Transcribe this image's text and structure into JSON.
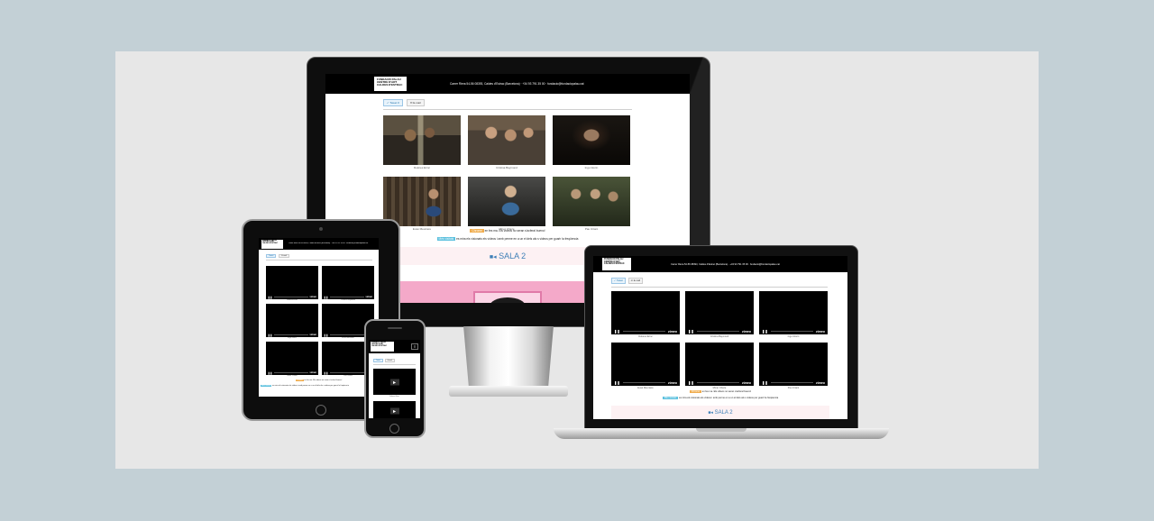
{
  "site": {
    "logo_lines": [
      "FUNDACIÓ PALAU",
      "CENTRE D'ART",
      "CALDES D'ESTRAC"
    ],
    "contact": "Carrer Riera 54-56 08393, Caldes d'Estrac (Barcelona) · +34 93 791 35 00 · fundacio@fundaciopalau.cat",
    "tweet_label": "Tweet",
    "tweet_count": "0",
    "email_label": "E-mail",
    "orange_badge": "Chrome",
    "orange_note": "en fes ma. Els videos no seran s'acferal bueno!",
    "blue_badge": "Més visitats",
    "blue_note": "es mira els visionats els vídeos i amb perme en a un el dels als s videos per guarir la freqüencia",
    "sala_label": "SALA 2",
    "video_captions": [
      "Dolores Erinc",
      "Cristina Baymond",
      "Ingo Glorin",
      "Eusé Meuniere",
      "Miner Chaze",
      "Pau Urtant"
    ],
    "vimeo_label": "vimeo",
    "pause_glyph": "❚❚",
    "play_glyph": "▶"
  },
  "devices": {
    "desktop": "desktop-monitor",
    "laptop": "laptop",
    "tablet": "tablet",
    "phone": "phone"
  },
  "colors": {
    "background": "#c3d0d6",
    "panel": "#e7e7e7",
    "accent_pink": "#f4a9c9",
    "accent_blue": "#3d7fb7",
    "badge_orange": "#f0ad4e",
    "badge_blue": "#5bc0de"
  },
  "icons": {
    "video": "video-camera-icon",
    "twitter": "twitter-icon",
    "email": "email-icon",
    "menu": "hamburger-menu-icon"
  }
}
